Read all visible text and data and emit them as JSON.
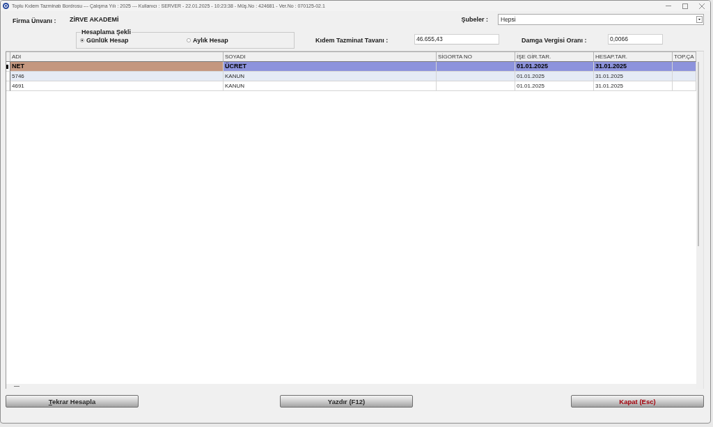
{
  "window": {
    "title": "Toplu Kıdem Tazminatı Bordrosu --- Çalışma Yılı : 2025 --- Kullanıcı : SERVER - 22.01.2025 - 10:23:38 - Müş.No : 424681 - Ver.No : 070125-02.1"
  },
  "firma": {
    "label": "Firma Ünvanı :",
    "value": "ZİRVE AKADEMİ"
  },
  "subeler": {
    "label": "Şubeler :",
    "value": "Hepsi"
  },
  "hesaplama_sekli": {
    "title": "Hesaplama Şekli",
    "options": [
      {
        "label": "Günlük Hesap",
        "selected": true
      },
      {
        "label": "Aylık Hesap",
        "selected": false
      }
    ]
  },
  "kidem_tazminat_tavani": {
    "label": "Kıdem Tazminat Tavanı :",
    "value": "46.655,43"
  },
  "damga_vergisi_orani": {
    "label": "Damga Vergisi Oranı :",
    "value": "0,0066"
  },
  "table": {
    "columns": [
      "ADI",
      "SOYADI",
      "SİGORTA NO",
      "İŞE GİR.TAR.",
      "HESAP.TAR.",
      "TOP.ÇA"
    ],
    "rows": [
      {
        "selected": true,
        "cells": [
          {
            "text": "NET",
            "focused": true
          },
          {
            "text": "ÜCRET",
            "focused": false
          },
          {
            "focused": false
          },
          {
            "text": "01.01.2025",
            "focused": false
          },
          {
            "text": "31.01.2025",
            "focused": false
          },
          {
            "focused": false
          }
        ]
      },
      {
        "selected": false,
        "cells": [
          {
            "text": "5746",
            "focused": false
          },
          {
            "text": "KANUN",
            "focused": false
          },
          {
            "focused": false
          },
          {
            "text": "01.01.2025",
            "focused": false
          },
          {
            "text": "31.01.2025",
            "focused": false
          },
          {
            "focused": false
          }
        ]
      },
      {
        "selected": false,
        "cells": [
          {
            "text": "4691",
            "focused": false
          },
          {
            "text": "KANUN",
            "focused": false
          },
          {
            "focused": false
          },
          {
            "text": "01.01.2025",
            "focused": false
          },
          {
            "text": "31.01.2025",
            "focused": false
          },
          {
            "focused": false
          }
        ]
      }
    ]
  },
  "buttons": [
    {
      "label": "Tekrar Hesapla",
      "kind": "normal",
      "hotkey_underline": true
    },
    {
      "label": "Yazdır (F12)",
      "kind": "normal",
      "hotkey_underline": false
    },
    {
      "label": "Kapat (Esc)",
      "kind": "close",
      "hotkey_underline": false
    }
  ]
}
